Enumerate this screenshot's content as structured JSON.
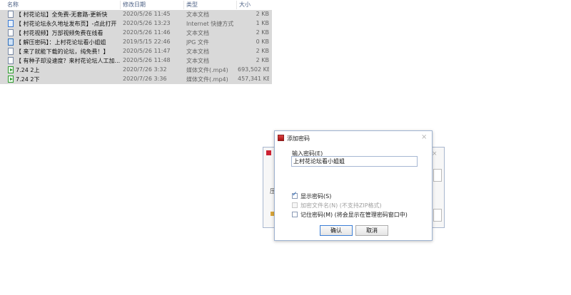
{
  "file_list": {
    "columns": {
      "name": "名称",
      "date": "修改日期",
      "type": "类型",
      "size": "大小"
    },
    "rows": [
      {
        "name": "【 村花论坛】全免费-无套路-更新快",
        "date": "2020/5/26 11:45",
        "type": "文本文档",
        "size": "2 KB",
        "icon": "text-file-icon",
        "kind": "txt"
      },
      {
        "name": "【 村花论坛永久地址发布页】-点此打开",
        "date": "2020/5/26 13:23",
        "type": "Internet 快捷方式",
        "size": "1 KB",
        "icon": "internet-shortcut-icon",
        "kind": "url"
      },
      {
        "name": "【 村花视频】万部视频免费在线看",
        "date": "2020/5/26 11:46",
        "type": "文本文档",
        "size": "2 KB",
        "icon": "text-file-icon",
        "kind": "txt"
      },
      {
        "name": "【 解压密码】：上村花论坛看小姐姐",
        "date": "2019/5/15 22:46",
        "type": "JPG 文件",
        "size": "0 KB",
        "icon": "image-file-icon",
        "kind": "jpg"
      },
      {
        "name": "【 来了就能下载的论坛，纯免费！】",
        "date": "2020/5/26 11:47",
        "type": "文本文档",
        "size": "2 KB",
        "icon": "text-file-icon",
        "kind": "txt"
      },
      {
        "name": "【 有种子却没速度？来村花论坛人工加...",
        "date": "2020/5/26 11:48",
        "type": "文本文档",
        "size": "2 KB",
        "icon": "text-file-icon",
        "kind": "txt"
      },
      {
        "name": "7.24 2上",
        "date": "2020/7/26 3:32",
        "type": "媒体文件(.mp4)",
        "size": "693,502 KB",
        "icon": "video-file-icon",
        "kind": "mp4"
      },
      {
        "name": "7.24 2下",
        "date": "2020/7/26 3:36",
        "type": "媒体文件(.mp4)",
        "size": "457,341 KB",
        "icon": "video-file-icon",
        "kind": "mp4"
      }
    ]
  },
  "back_dialog": {
    "label_compress": "压",
    "close_glyph": "⨯"
  },
  "password_dialog": {
    "title": "添加密码",
    "close_glyph": "⨯",
    "password_label": "输入密码(E)",
    "password_value": "上村花论坛看小姐姐",
    "options": [
      {
        "label": "显示密码(S)",
        "checked": true,
        "disabled": false
      },
      {
        "label": "加密文件名(N) (不支持ZIP格式)",
        "checked": false,
        "disabled": true
      },
      {
        "label": "记住密码(M) (将会显示在管理密码窗口中)",
        "checked": false,
        "disabled": false
      }
    ],
    "ok_label": "确认",
    "cancel_label": "取消"
  }
}
